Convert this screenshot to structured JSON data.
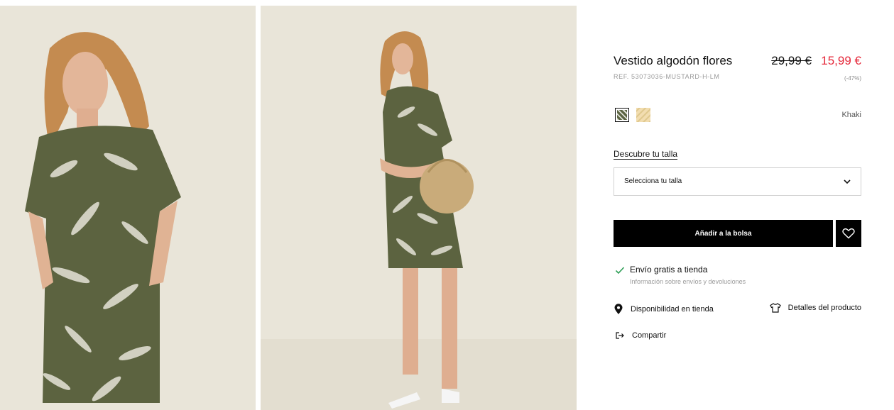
{
  "product": {
    "title": "Vestido algodón flores",
    "ref": "REF. 53073036-MUSTARD-H-LM",
    "price_old": "29,99 €",
    "price_new": "15,99 €",
    "discount": "(-47%)"
  },
  "colors": {
    "selected_name": "Khaki",
    "swatches": [
      "khaki-floral",
      "mustard-floral"
    ],
    "accent_sale": "#e5283a"
  },
  "size": {
    "guide_label": "Descubre tu talla",
    "select_label": "Selecciona tu talla"
  },
  "actions": {
    "add_label": "Añadir a la bolsa",
    "favorite_icon": "heart-icon"
  },
  "shipping": {
    "main": "Envío gratis a tienda",
    "sub": "Información sobre envíos y devoluciones"
  },
  "links": {
    "availability": "Disponibilidad en tienda",
    "details": "Detalles del producto",
    "share": "Compartir"
  }
}
